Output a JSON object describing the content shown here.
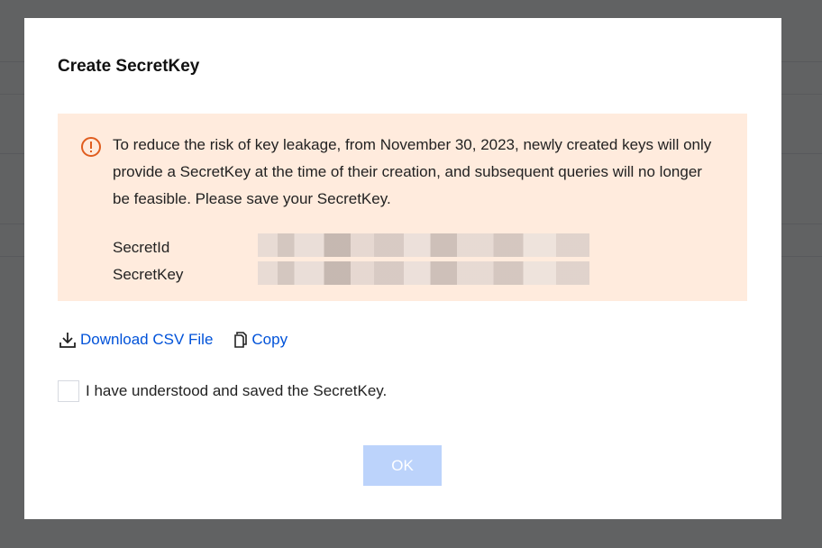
{
  "background": {
    "partial_text": "e"
  },
  "dialog": {
    "title": "Create SecretKey",
    "notice": {
      "icon": "warning-circle-icon",
      "text": "To reduce the risk of key leakage, from November 30, 2023, newly created keys will only provide a SecretKey at the time of their creation, and subsequent queries will no longer be feasible. Please save your SecretKey."
    },
    "secret_id_label": "SecretId",
    "secret_key_label": "SecretKey",
    "download_label": "Download CSV File",
    "copy_label": "Copy",
    "confirm_label": "I have understood and saved the SecretKey.",
    "ok_label": "OK"
  },
  "colors": {
    "accent": "#0052d9",
    "notice_bg": "#ffebdd",
    "warning_icon": "#e05d1f",
    "ok_disabled": "#bcd3fb"
  }
}
